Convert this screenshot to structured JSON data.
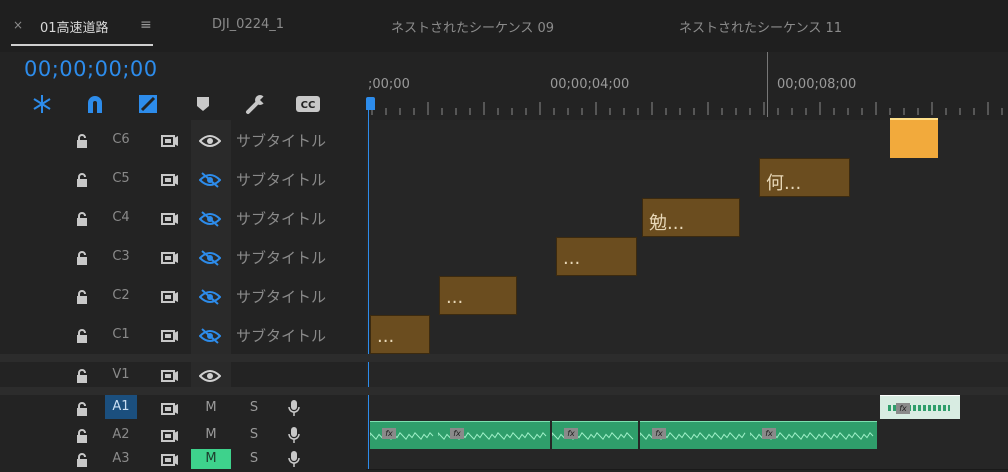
{
  "tabs": [
    {
      "label": "01高速道路",
      "active": true
    },
    {
      "label": "DJI_0224_1",
      "active": false
    },
    {
      "label": "ネストされたシーケンス 09",
      "active": false
    },
    {
      "label": "ネストされたシーケンス 11",
      "active": false
    }
  ],
  "tab_close": "×",
  "tab_menu": "≡",
  "timecode": "00;00;00;00",
  "ruler_labels": [
    ";00;00",
    "00;00;04;00",
    "00;00;08;00"
  ],
  "tracks": {
    "caption": [
      {
        "name": "C6",
        "label": "サブタイトル",
        "visible": true
      },
      {
        "name": "C5",
        "label": "サブタイトル",
        "visible": false
      },
      {
        "name": "C4",
        "label": "サブタイトル",
        "visible": false
      },
      {
        "name": "C3",
        "label": "サブタイトル",
        "visible": false
      },
      {
        "name": "C2",
        "label": "サブタイトル",
        "visible": false
      },
      {
        "name": "C1",
        "label": "サブタイトル",
        "visible": false
      }
    ],
    "video": [
      {
        "name": "V1"
      }
    ],
    "audio": [
      {
        "name": "A1",
        "m": "M",
        "s": "S",
        "selected": true
      },
      {
        "name": "A2",
        "m": "M",
        "s": "S"
      },
      {
        "name": "A3",
        "m": "M",
        "s": "S",
        "mute_on": true
      }
    ]
  },
  "subtitle_clips": [
    {
      "track": "C5",
      "text": "何..."
    },
    {
      "track": "C4",
      "text": "勉..."
    },
    {
      "track": "C3",
      "text": "..."
    },
    {
      "track": "C2",
      "text": "..."
    },
    {
      "track": "C1",
      "text": "..."
    }
  ],
  "fx_label": "fx",
  "colors": {
    "accent": "#2d8ceb",
    "subtitle_clip": "#6b4d1f",
    "selected_clip": "#f2aa3c",
    "audio_clip": "#2f9e6b"
  }
}
